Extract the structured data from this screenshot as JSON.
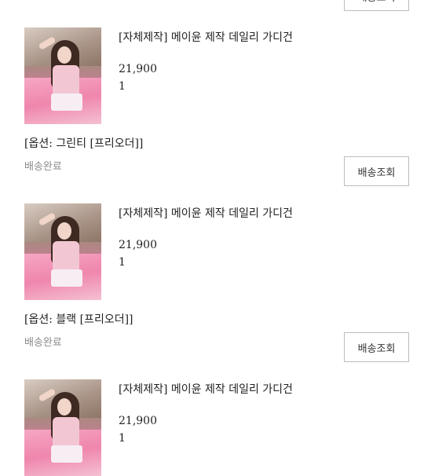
{
  "orders": [
    {
      "product_name": "",
      "price": "",
      "quantity": "",
      "option": "",
      "status": "",
      "track_button": "배송조회"
    },
    {
      "product_name": "[자체제작] 메이윤 제작 데일리 가디건",
      "price": "21,900",
      "quantity": "1",
      "option": "[옵션: 그린티 [프리오더]]",
      "status": "배송완료",
      "track_button": "배송조회"
    },
    {
      "product_name": "[자체제작] 메이윤 제작 데일리 가디건",
      "price": "21,900",
      "quantity": "1",
      "option": "[옵션: 블랙 [프리오더]]",
      "status": "배송완료",
      "track_button": "배송조회"
    },
    {
      "product_name": "[자체제작] 메이윤 제작 데일리 가디건",
      "price": "21,900",
      "quantity": "1",
      "option": "",
      "status": "",
      "track_button": ""
    }
  ]
}
